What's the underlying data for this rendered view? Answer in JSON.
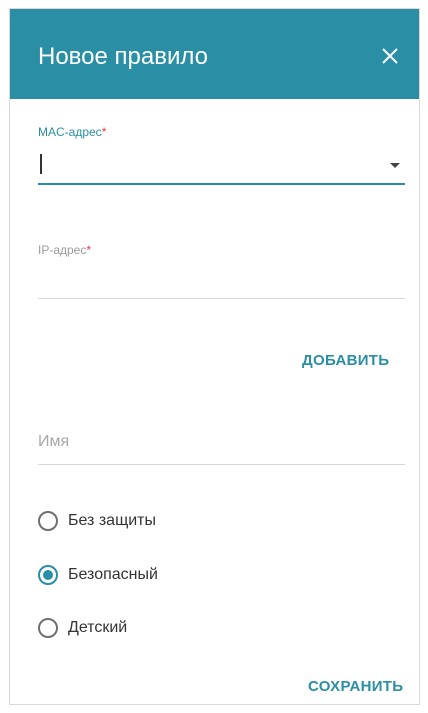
{
  "dialog": {
    "title": "Новое правило",
    "close_icon": "close-icon"
  },
  "mac_field": {
    "label": "MAC-адрес",
    "required_mark": "*",
    "value": "",
    "dropdown_icon": "caret-down-icon"
  },
  "ip_field": {
    "label": "IP-адрес",
    "required_mark": "*",
    "value": ""
  },
  "add_button": {
    "label": "ДОБАВИТЬ"
  },
  "name_field": {
    "placeholder": "Имя",
    "value": ""
  },
  "security_options": {
    "selected": "Безопасный",
    "items": [
      {
        "label": "Без защиты",
        "checked": false
      },
      {
        "label": "Безопасный",
        "checked": true
      },
      {
        "label": "Детский",
        "checked": false
      }
    ]
  },
  "save_button": {
    "label": "СОХРАНИТЬ"
  },
  "colors": {
    "accent": "#2a8fa4",
    "required": "#e53935",
    "header_text": "#ffffff"
  }
}
